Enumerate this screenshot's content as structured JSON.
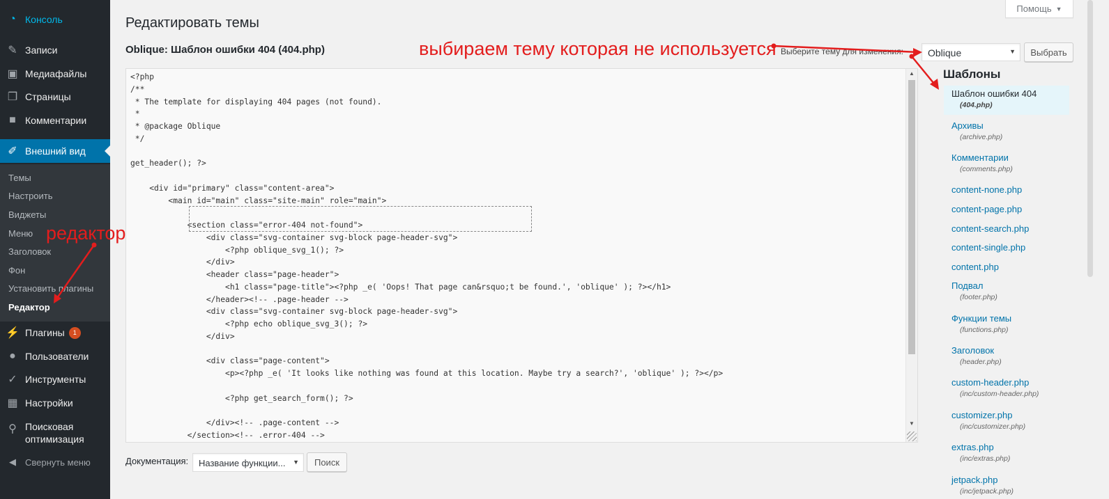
{
  "sidebar": {
    "menu": [
      {
        "label": "Консоль",
        "icon": "dashboard-icon"
      },
      {
        "label": "Записи",
        "icon": "pin-icon"
      },
      {
        "label": "Медиафайлы",
        "icon": "media-icon"
      },
      {
        "label": "Страницы",
        "icon": "pages-icon"
      },
      {
        "label": "Комментарии",
        "icon": "comments-icon"
      },
      {
        "label": "Внешний вид",
        "icon": "brush-icon"
      },
      {
        "label": "Плагины",
        "icon": "plugin-icon",
        "badge": "1"
      },
      {
        "label": "Пользователи",
        "icon": "users-icon"
      },
      {
        "label": "Инструменты",
        "icon": "wrench-icon"
      },
      {
        "label": "Настройки",
        "icon": "settings-icon"
      },
      {
        "label": "Поисковая оптимизация",
        "icon": "search-icon"
      }
    ],
    "submenu": [
      "Темы",
      "Настроить",
      "Виджеты",
      "Меню",
      "Заголовок",
      "Фон",
      "Установить плагины",
      "Редактор"
    ],
    "collapse_label": "Свернуть меню"
  },
  "header": {
    "help_label": "Помощь",
    "page_title": "Редактировать темы",
    "file_title": "Oblique: Шаблон ошибки 404 (404.php)"
  },
  "theme_picker": {
    "label": "Выберите тему для изменения:",
    "selected": "Oblique",
    "button": "Выбрать"
  },
  "editor": {
    "lines": [
      "<?php",
      "/**",
      " * The template for displaying 404 pages (not found).",
      " *",
      " * @package Oblique",
      " */",
      "",
      "get_header(); ?>",
      "",
      "    <div id=\"primary\" class=\"content-area\">",
      "        <main id=\"main\" class=\"site-main\" role=\"main\">",
      "",
      "            <section class=\"error-404 not-found\">",
      "                <div class=\"svg-container svg-block page-header-svg\">",
      "                    <?php oblique_svg_1(); ?>",
      "                </div>",
      "                <header class=\"page-header\">",
      "                    <h1 class=\"page-title\"><?php _e( 'Oops! That page can&rsquo;t be found.', 'oblique' ); ?></h1>",
      "                </header><!-- .page-header -->",
      "                <div class=\"svg-container svg-block page-header-svg\">",
      "                    <?php echo oblique_svg_3(); ?>",
      "                </div>",
      "",
      "                <div class=\"page-content\">",
      "                    <p><?php _e( 'It looks like nothing was found at this location. Maybe try a search?', 'oblique' ); ?></p>",
      "",
      "                    <?php get_search_form(); ?>",
      "",
      "                </div><!-- .page-content -->",
      "            </section><!-- .error-404 -->"
    ]
  },
  "templates": {
    "heading": "Шаблоны",
    "items": [
      {
        "name": "Шаблон ошибки 404",
        "file": "(404.php)"
      },
      {
        "name": "Архивы",
        "file": "(archive.php)"
      },
      {
        "name": "Комментарии",
        "file": "(comments.php)"
      },
      {
        "name": "content-none.php",
        "file": ""
      },
      {
        "name": "content-page.php",
        "file": ""
      },
      {
        "name": "content-search.php",
        "file": ""
      },
      {
        "name": "content-single.php",
        "file": ""
      },
      {
        "name": "content.php",
        "file": ""
      },
      {
        "name": "Подвал",
        "file": "(footer.php)"
      },
      {
        "name": "Функции темы",
        "file": "(functions.php)"
      },
      {
        "name": "Заголовок",
        "file": "(header.php)"
      },
      {
        "name": "custom-header.php",
        "file": "(inc/custom-header.php)"
      },
      {
        "name": "customizer.php",
        "file": "(inc/customizer.php)"
      },
      {
        "name": "extras.php",
        "file": "(inc/extras.php)"
      },
      {
        "name": "jetpack.php",
        "file": "(inc/jetpack.php)"
      }
    ]
  },
  "documentation": {
    "label": "Документация:",
    "select_value": "Название функции...",
    "button": "Поиск"
  },
  "annotations": {
    "theme_note": "выбираем тему которая не используется",
    "editor_note": "редактор",
    "color": "#e31d1d"
  },
  "colors": {
    "sidebar_bg": "#23282d",
    "active_bg": "#0073aa",
    "link": "#0073aa"
  }
}
